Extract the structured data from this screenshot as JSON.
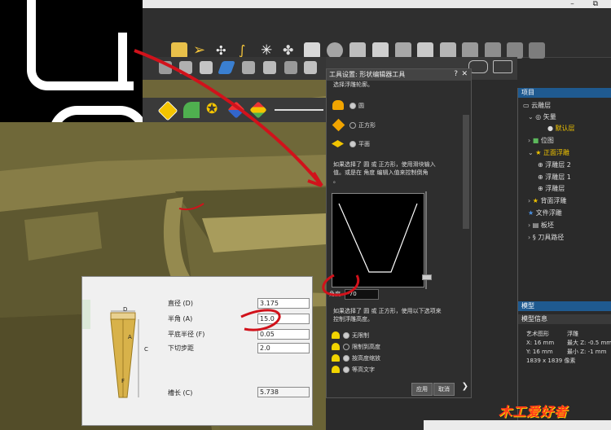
{
  "window": {
    "title": "",
    "controls": "–  ⧉"
  },
  "dialog": {
    "title": "工具设置: 形状编辑器工具",
    "help": "?",
    "close": "✕",
    "intro_text": "选择浮雕轮廓。",
    "shape_options": [
      "圆",
      "正方形",
      "平面"
    ],
    "angle_hint_1": "如果选择了 圆 或 正方形，使用滑块输入",
    "angle_hint_2": "值。或是在 角度 编辑入值来控制倒角",
    "angle_hint_3": "。",
    "angle_label": "角度",
    "angle_value": "-70",
    "height_hint_1": "如果选择了 圆 或 正方形，使用以下选项来",
    "height_hint_2": "控制浮雕高度。",
    "height_options": [
      "无限制",
      "限制到高度",
      "按高度缩放",
      "等高文字"
    ],
    "apply_button": "应用",
    "cancel_button": "取消"
  },
  "project_panel": {
    "header": "项目",
    "items": [
      {
        "label": "云雕层"
      },
      {
        "label": "矢量"
      },
      {
        "label": "默认层"
      },
      {
        "label": "位图"
      },
      {
        "label": "正面浮雕"
      },
      {
        "label": "浮雕层 2"
      },
      {
        "label": "浮雕层 1"
      },
      {
        "label": "浮雕层"
      },
      {
        "label": "背面浮雕"
      },
      {
        "label": "文件浮雕"
      },
      {
        "label": "板坯"
      },
      {
        "label": "刀具路径"
      }
    ]
  },
  "model_panel": {
    "tab": "模型",
    "header": "模型信息",
    "art_shape_label": "艺术图形",
    "relief_label": "浮雕",
    "x_label": "X: 16 mm",
    "y_label": "Y: 16 mm",
    "max_z": "最大 Z: -0.5 mm",
    "min_z": "最小 Z: -1 mm",
    "pixels": "1839 x 1839 像素"
  },
  "tool_dialog": {
    "fields": [
      {
        "label": "直径 (D)",
        "value": "3.175"
      },
      {
        "label": "半角 (A)",
        "value": "15.0"
      },
      {
        "label": "平底半径 (F)",
        "value": "0.05"
      },
      {
        "label": "下切步距",
        "value": "2.0"
      }
    ],
    "length_label": "槽长 (C)",
    "length_value": "5.738",
    "diagram_labels": {
      "d": "D",
      "a": "A",
      "c": "C",
      "f": "F"
    }
  },
  "logo_text": "爱好者",
  "logo_mark": "木工",
  "colors": {
    "relief": "#7a7240",
    "accent": "#1f5a90",
    "bell": "#f1d400",
    "annotation": "#d1121b"
  }
}
